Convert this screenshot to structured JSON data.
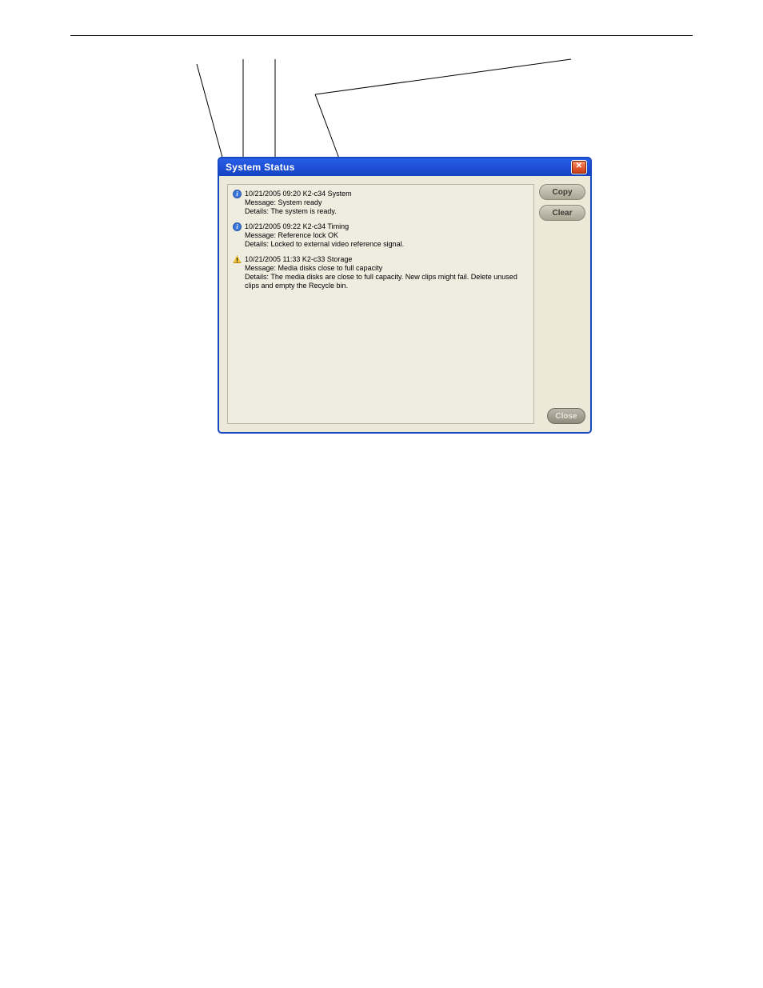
{
  "dialog": {
    "title": "System Status",
    "buttons": {
      "copy": "Copy",
      "clear": "Clear",
      "close": "Close"
    }
  },
  "entries": [
    {
      "icon": "info",
      "header": "10/21/2005 09:20 K2-c34 System",
      "message": "Message: System ready",
      "details": "Details: The system is ready."
    },
    {
      "icon": "info",
      "header": "10/21/2005 09:22 K2-c34 Timing",
      "message": "Message: Reference lock OK",
      "details": "Details: Locked to external video reference signal."
    },
    {
      "icon": "warn",
      "header": "10/21/2005 11:33 K2-c33 Storage",
      "message": "Message: Media disks close to full capacity",
      "details": "Details: The media disks are close to full capacity. New clips might fail. Delete unused clips and empty the Recycle bin."
    }
  ]
}
